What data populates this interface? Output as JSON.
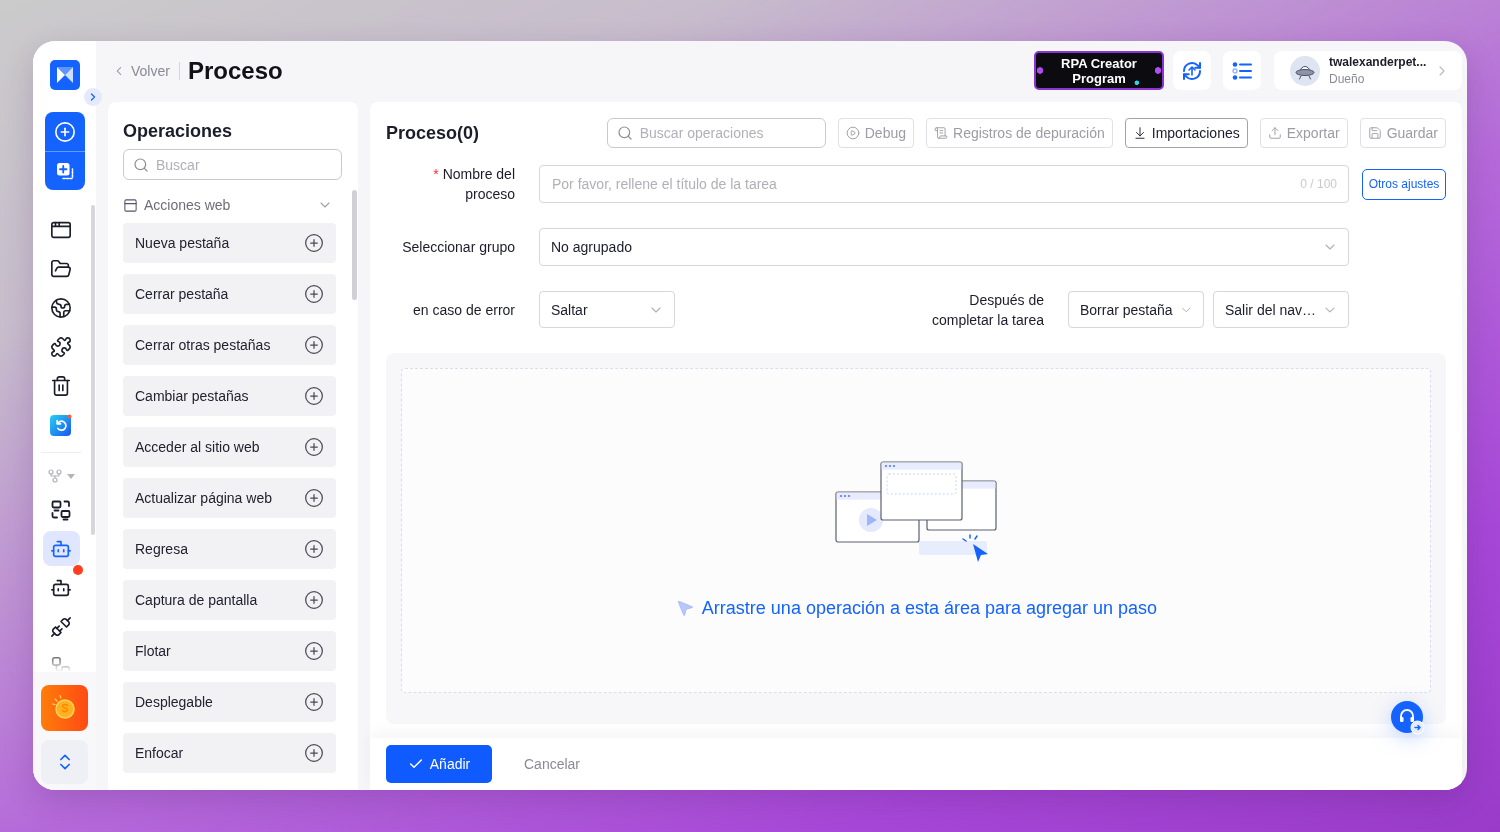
{
  "sidebar": {
    "nav_items": [
      {
        "selected": false
      },
      {
        "selected": false
      },
      {
        "selected": false
      },
      {
        "selected": false
      },
      {
        "selected": false
      },
      {
        "selected": false
      }
    ],
    "tool_items": [
      {
        "selected": false,
        "notification": false
      },
      {
        "selected": true,
        "notification": true
      },
      {
        "selected": false,
        "notification": false
      },
      {
        "selected": false,
        "notification": false
      },
      {
        "selected": false,
        "notification": false
      }
    ]
  },
  "header": {
    "back": "Volver",
    "title": "Proceso",
    "promo_badge": "RPA Creator Program",
    "user": {
      "name": "twalexanderpet...",
      "role": "Dueño"
    }
  },
  "operations": {
    "title": "Operaciones",
    "search": {
      "placeholder": "Buscar"
    },
    "category": {
      "label": "Acciones web",
      "expanded": true,
      "items": [
        "Nueva pestaña",
        "Cerrar pestaña",
        "Cerrar otras pestañas",
        "Cambiar pestañas",
        "Acceder al sitio web",
        "Actualizar página web",
        "Regresa",
        "Captura de pantalla",
        "Flotar",
        "Desplegable",
        "Enfocar"
      ]
    }
  },
  "editor": {
    "title": "Proceso(0)",
    "search": {
      "placeholder": "Buscar operaciones"
    },
    "toolbar": [
      {
        "label": "Debug",
        "disabled": true
      },
      {
        "label": "Registros de depuración",
        "disabled": true
      },
      {
        "label": "Importaciones",
        "disabled": false
      },
      {
        "label": "Exportar",
        "disabled": true
      },
      {
        "label": "Guardar",
        "disabled": true
      }
    ],
    "name_field": {
      "required_mark": "*",
      "label": "Nombre del proceso",
      "placeholder": "Por favor, rellene el título de la tarea",
      "counter": "0 / 100"
    },
    "settings_button": "Otros ajustes",
    "group_select": {
      "label": "Seleccionar grupo",
      "value": "No agrupado"
    },
    "error_select": {
      "label": "en caso de error",
      "value": "Saltar"
    },
    "after_task": {
      "label": "Después de completar la tarea",
      "values": [
        "Borrar pestaña",
        "Salir del nav…"
      ]
    },
    "drop_hint": "Arrastre una operación a esta área para agregar un paso",
    "actions": {
      "primary": "Añadir",
      "secondary": "Cancelar"
    }
  }
}
